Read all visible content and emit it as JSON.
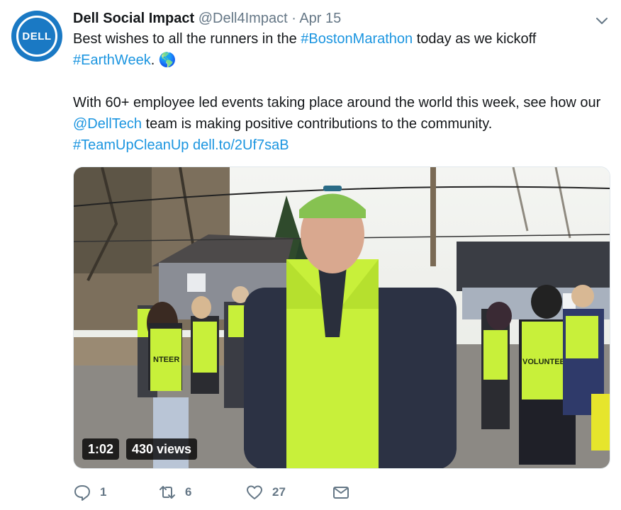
{
  "tweet": {
    "author_name": "Dell Social Impact",
    "handle": "@Dell4Impact",
    "separator": "·",
    "date": "Apr 15",
    "avatar_logo": "DELL",
    "line1_prefix": "Best wishes to all the runners in the ",
    "hashtag_boston": "#BostonMarathon",
    "line1_suffix": " today as we kickoff",
    "hashtag_earthweek": "#EarthWeek",
    "period": ".",
    "globe_emoji": "🌎",
    "para2_prefix": "With 60+ employee led events taking place around the world this week, see how our ",
    "mention": "@DellTech",
    "para2_suffix": " team is making positive contributions to the community.",
    "hashtag_teamup": "#TeamUpCleanUp",
    "short_link": "dell.to/2Uf7saB"
  },
  "video": {
    "duration": "1:02",
    "views": "430 views",
    "vest_text_left": "NTEER",
    "vest_text_right": "VOLUNTEER"
  },
  "actions": {
    "replies": "1",
    "retweets": "6",
    "likes": "27"
  },
  "colors": {
    "link": "#1b95e0",
    "muted": "#657786",
    "dell_blue": "#1a79c4",
    "vest": "#c8f03a"
  },
  "icons": [
    "chevron-down-icon",
    "reply-icon",
    "retweet-icon",
    "like-icon",
    "message-icon"
  ]
}
